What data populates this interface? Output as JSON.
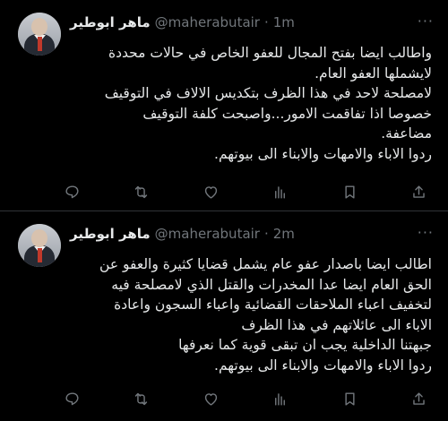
{
  "tweets": [
    {
      "name": "ماهر ابوطير",
      "handle": "@maherabutair",
      "dot": "·",
      "time": "1m",
      "lines": [
        "واطالب ايضا بفتح المجال للعفو الخاص في حالات محددة",
        "لايشملها العفو العام.",
        "لامصلحة لاحد في هذا الظرف بتكديس الالاف في التوقيف",
        "خصوصا اذا تفاقمت الامور...واصبحت كلفة التوقيف",
        "مضاعفة.",
        "ردوا الاباء والامهات والابناء الى بيوتهم."
      ],
      "icons": [
        "reply-icon",
        "retweet-icon",
        "like-icon",
        "views-icon",
        "bookmark-icon",
        "share-icon"
      ]
    },
    {
      "name": "ماهر ابوطير",
      "handle": "@maherabutair",
      "dot": "·",
      "time": "2m",
      "lines": [
        "اطالب ايضا باصدار عفو عام يشمل قضايا كثيرة والعفو عن",
        "الحق العام ايضا عدا المخدرات والقتل الذي لامصلحة فيه",
        "لتخفيف اعباء الملاحقات القضائية واعباء السجون واعادة",
        "الاباء الى عائلاتهم في هذا الظرف",
        "جبهتنا الداخلية يجب ان تبقى قوية كما نعرفها",
        "ردوا الاباء والامهات والابناء الى بيوتهم."
      ],
      "icons": [
        "reply-icon",
        "retweet-icon",
        "like-icon",
        "views-icon",
        "bookmark-icon",
        "share-icon"
      ]
    }
  ],
  "more_glyph": "···",
  "colors": {
    "background": "#000000",
    "text": "#e7e9ea",
    "muted": "#71767b",
    "divider": "#2f3336"
  }
}
